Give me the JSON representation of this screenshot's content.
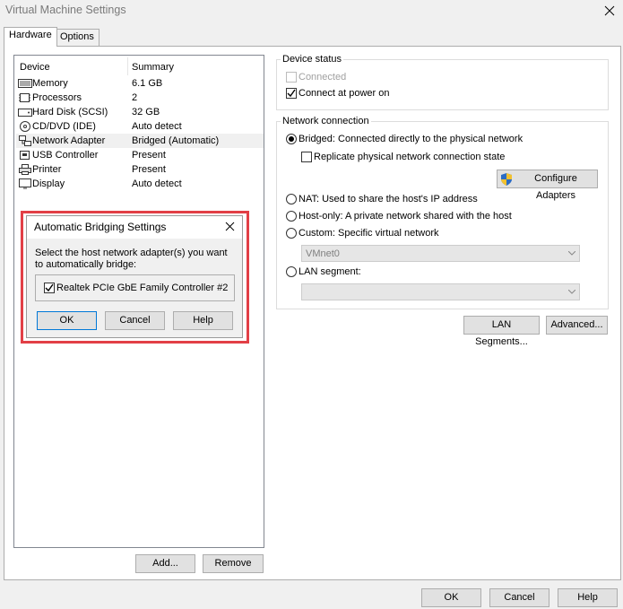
{
  "window": {
    "title": "Virtual Machine Settings"
  },
  "tabs": [
    {
      "label": "Hardware"
    },
    {
      "label": "Options"
    }
  ],
  "device_list": {
    "header_device": "Device",
    "header_summary": "Summary",
    "items": [
      {
        "name": "Memory",
        "summary": "6.1 GB",
        "icon": "memory-icon"
      },
      {
        "name": "Processors",
        "summary": "2",
        "icon": "processor-icon"
      },
      {
        "name": "Hard Disk (SCSI)",
        "summary": "32 GB",
        "icon": "hard-disk-icon"
      },
      {
        "name": "CD/DVD (IDE)",
        "summary": "Auto detect",
        "icon": "cd-dvd-icon"
      },
      {
        "name": "Network Adapter",
        "summary": "Bridged (Automatic)",
        "icon": "network-adapter-icon"
      },
      {
        "name": "USB Controller",
        "summary": "Present",
        "icon": "usb-icon"
      },
      {
        "name": "Printer",
        "summary": "Present",
        "icon": "printer-icon"
      },
      {
        "name": "Display",
        "summary": "Auto detect",
        "icon": "display-icon"
      }
    ],
    "add_label": "Add...",
    "remove_label": "Remove"
  },
  "device_status": {
    "legend": "Device status",
    "connected": "Connected",
    "connect_at_power_on": "Connect at power on"
  },
  "network_connection": {
    "legend": "Network connection",
    "bridged": "Bridged: Connected directly to the physical network",
    "replicate": "Replicate physical network connection state",
    "configure_adapters": "Configure Adapters",
    "nat": "NAT: Used to share the host's IP address",
    "host_only": "Host-only: A private network shared with the host",
    "custom": "Custom: Specific virtual network",
    "custom_value": "VMnet0",
    "lan_segment": "LAN segment:",
    "lan_segment_value": ""
  },
  "buttons": {
    "lan_segments": "LAN Segments...",
    "advanced": "Advanced...",
    "ok": "OK",
    "cancel": "Cancel",
    "help": "Help"
  },
  "bridging_dialog": {
    "title": "Automatic Bridging Settings",
    "description": "Select the host network adapter(s) you want to automatically bridge:",
    "adapter": "Realtek PCIe GbE Family Controller #2",
    "ok": "OK",
    "cancel": "Cancel",
    "help": "Help"
  },
  "colors": {
    "highlight": "#e23f46",
    "focus": "#0078d7"
  }
}
